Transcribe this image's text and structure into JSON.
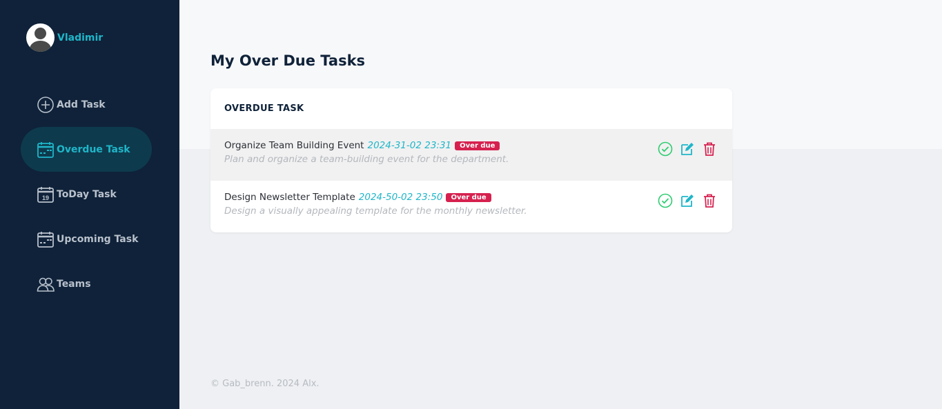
{
  "user": {
    "name": "Vladimir"
  },
  "nav": [
    {
      "label": "Add Task",
      "icon": "plus-circle-icon",
      "active": false
    },
    {
      "label": "Overdue Task",
      "icon": "calendar-icon",
      "active": true
    },
    {
      "label": "ToDay Task",
      "icon": "calendar-day-icon",
      "day": "19",
      "active": false
    },
    {
      "label": "Upcoming Task",
      "icon": "calendar-icon",
      "active": false
    },
    {
      "label": "Teams",
      "icon": "people-icon",
      "active": false
    }
  ],
  "page": {
    "title": "My Over Due Tasks"
  },
  "card": {
    "header": "OVERDUE TASK",
    "tasks": [
      {
        "title": "Organize Team Building Event",
        "date": "2024-31-02 23:31",
        "badge": "Over due",
        "description": "Plan and organize a team-building event for the department."
      },
      {
        "title": "Design Newsletter Template",
        "date": "2024-50-02 23:50",
        "badge": "Over due",
        "description": "Design a visually appealing template for the monthly newsletter."
      }
    ]
  },
  "footer": {
    "text": "© Gab_brenn. 2024 Alx."
  },
  "colors": {
    "sidebar": "#0f2239",
    "accent": "#1fb6c9",
    "active_bg": "#0e3a4d",
    "badge": "#d6214f",
    "complete": "#2ecc71",
    "edit": "#1fb6c9",
    "delete": "#d6214f"
  }
}
